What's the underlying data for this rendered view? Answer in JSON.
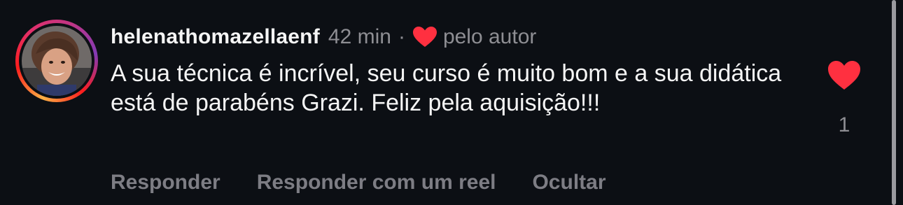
{
  "comment": {
    "username": "helenathomazellaenf",
    "time": "42 min",
    "separator": "·",
    "author_badge": "pelo autor",
    "text": "A sua técnica é incrível, seu curso é muito bom e a sua didática está de parabéns Grazi. Feliz pela aquisição!!!",
    "like_count": "1"
  },
  "actions": {
    "reply": "Responder",
    "reply_reel": "Responder com um reel",
    "hide": "Ocultar"
  },
  "icons": {
    "author_heart": "heart-icon",
    "like": "heart-icon"
  },
  "colors": {
    "background": "#0c0f14",
    "heart": "#ff3040",
    "text": "#f5f5f5",
    "muted": "#8e8e93"
  }
}
